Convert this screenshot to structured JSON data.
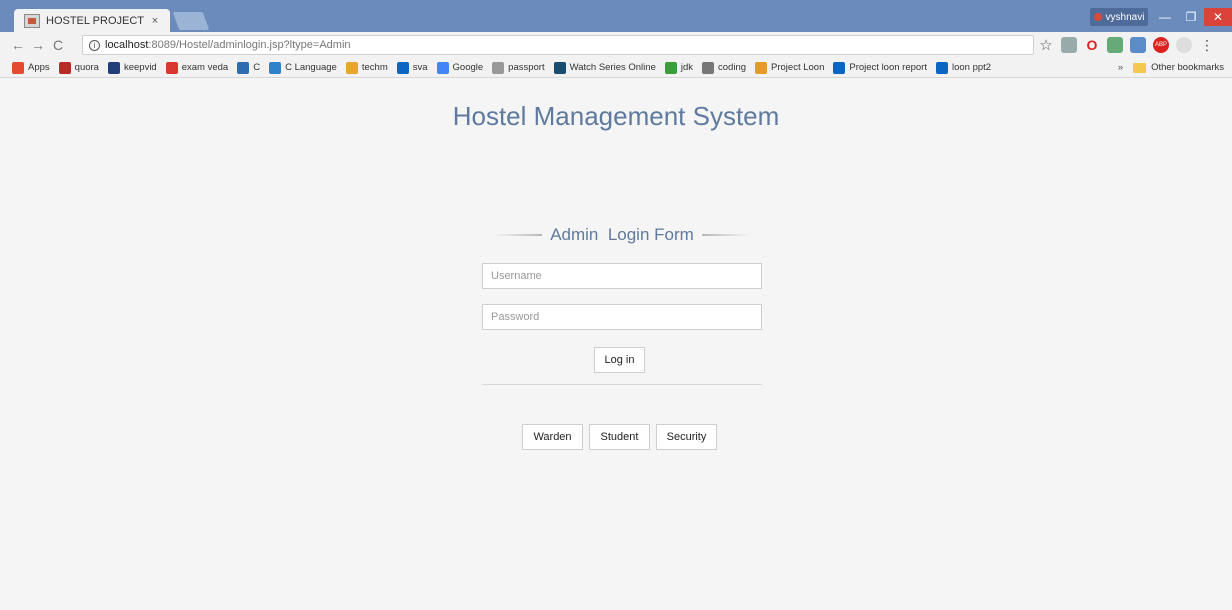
{
  "tab": {
    "title": "HOSTEL PROJECT",
    "close": "×"
  },
  "window": {
    "profile": "vyshnavi",
    "minimize": "—",
    "maximize": "❐",
    "close": "✕"
  },
  "nav": {
    "back": "←",
    "forward": "→",
    "reload": "C"
  },
  "address": {
    "host": "localhost",
    "rest": ":8089/Hostel/adminlogin.jsp?ltype=Admin",
    "info": "i"
  },
  "bookmarks": [
    {
      "label": "Apps",
      "icon": "apps-icon",
      "color": "#e34a2f"
    },
    {
      "label": "quora",
      "icon": "quora-icon",
      "color": "#b92b27"
    },
    {
      "label": "keepvid",
      "icon": "keepvid-icon",
      "color": "#1f3e7a"
    },
    {
      "label": "exam veda",
      "icon": "examveda-icon",
      "color": "#d8382e"
    },
    {
      "label": "C",
      "icon": "c-icon",
      "color": "#2f6bb0"
    },
    {
      "label": "C Language",
      "icon": "c-language-icon",
      "color": "#2f82c8"
    },
    {
      "label": "techm",
      "icon": "techm-icon",
      "color": "#e6a62a"
    },
    {
      "label": "sva",
      "icon": "linkedin-icon",
      "color": "#0a66c2"
    },
    {
      "label": "Google",
      "icon": "google-icon",
      "color": "#4285f4"
    },
    {
      "label": "passport",
      "icon": "page-icon",
      "color": "#999999"
    },
    {
      "label": "Watch Series Online",
      "icon": "watchseries-icon",
      "color": "#1a4e6e"
    },
    {
      "label": "jdk",
      "icon": "jdk-icon",
      "color": "#3c9d3c"
    },
    {
      "label": "coding",
      "icon": "coding-icon",
      "color": "#777777"
    },
    {
      "label": "Project Loon",
      "icon": "loon-icon",
      "color": "#e69a28"
    },
    {
      "label": "Project loon report",
      "icon": "linkedin-icon",
      "color": "#0a66c2"
    },
    {
      "label": "loon ppt2",
      "icon": "linkedin-icon",
      "color": "#0a66c2"
    }
  ],
  "bookmarks_more": "»",
  "other_bookmarks": "Other bookmarks",
  "page": {
    "title": "Hostel Management System",
    "form_heading": "Admin  Login Form",
    "username_placeholder": "Username",
    "password_placeholder": "Password",
    "login_button": "Log in",
    "warden_button": "Warden",
    "student_button": "Student",
    "security_button": "Security"
  }
}
